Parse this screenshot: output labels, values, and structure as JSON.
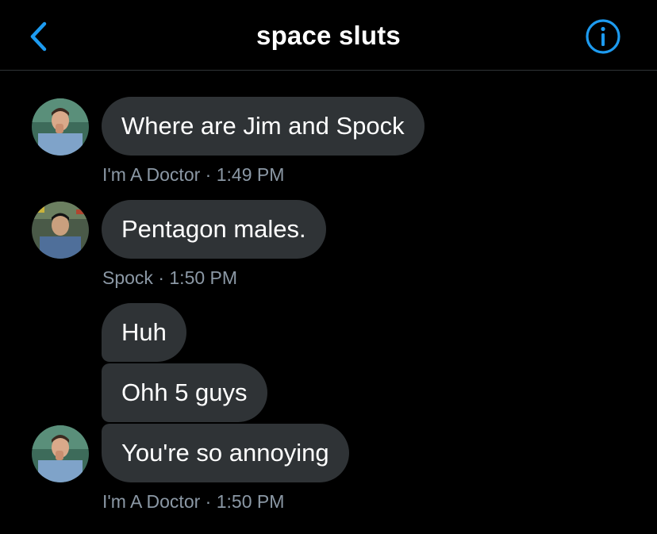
{
  "header": {
    "title": "space sluts",
    "back_icon": "chevron-left-icon",
    "info_icon": "info-circle-icon",
    "accent_color": "#1d9bf0"
  },
  "messages": [
    {
      "sender": "I'm A Doctor",
      "text": "Where are Jim and Spock"
    },
    {
      "sender": "Spock",
      "text": "Pentagon males."
    },
    {
      "sender": "I'm A Doctor",
      "text": "Huh"
    },
    {
      "sender": "I'm A Doctor",
      "text": "Ohh 5 guys"
    },
    {
      "sender": "I'm A Doctor",
      "text": "You're so annoying"
    }
  ],
  "timestamps": [
    {
      "sender": "I'm A Doctor",
      "separator": " · ",
      "time": "1:49 PM"
    },
    {
      "sender": "Spock",
      "separator": " · ",
      "time": "1:50 PM"
    },
    {
      "sender": "I'm A Doctor",
      "separator": " · ",
      "time": "1:50 PM"
    }
  ],
  "colors": {
    "background": "#000000",
    "bubble": "#2f3336",
    "meta_text": "#8b98a5",
    "divider": "#2f3336"
  }
}
